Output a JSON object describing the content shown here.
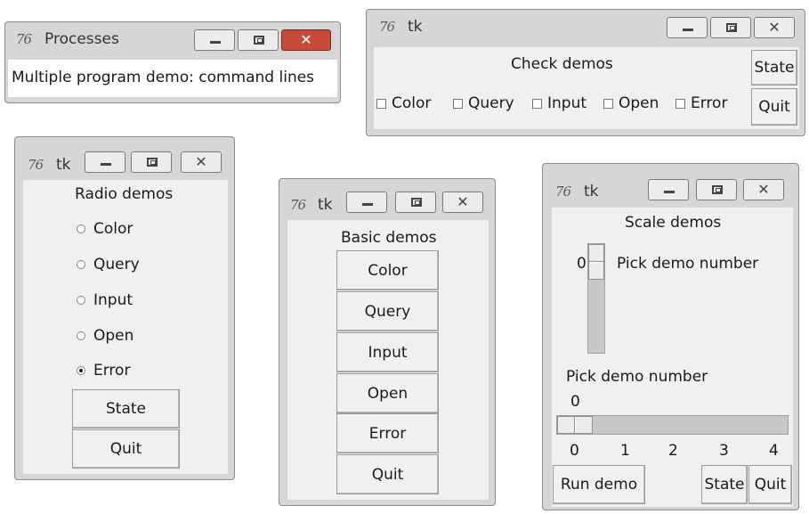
{
  "processes": {
    "title": "Processes",
    "logo": "76",
    "message": "Multiple program demo: command lines"
  },
  "check_win": {
    "title": "tk",
    "logo": "76",
    "heading": "Check demos",
    "checks": [
      "Color",
      "Query",
      "Input",
      "Open",
      "Error"
    ],
    "state_label": "State",
    "quit_label": "Quit"
  },
  "radio_win": {
    "title": "tk",
    "logo": "76",
    "heading": "Radio demos",
    "options": [
      "Color",
      "Query",
      "Input",
      "Open",
      "Error"
    ],
    "selected": "Error",
    "state_label": "State",
    "quit_label": "Quit"
  },
  "basic_win": {
    "title": "tk",
    "logo": "76",
    "heading": "Basic demos",
    "buttons": [
      "Color",
      "Query",
      "Input",
      "Open",
      "Error",
      "Quit"
    ]
  },
  "scale_win": {
    "title": "tk",
    "logo": "76",
    "heading": "Scale demos",
    "vscale_value": "0",
    "vscale_label": "Pick demo number",
    "hscale_label": "Pick demo number",
    "hscale_value": "0",
    "hscale_ticks": [
      "0",
      "1",
      "2",
      "3",
      "4"
    ],
    "run_label": "Run demo",
    "state_label": "State",
    "quit_label": "Quit"
  }
}
